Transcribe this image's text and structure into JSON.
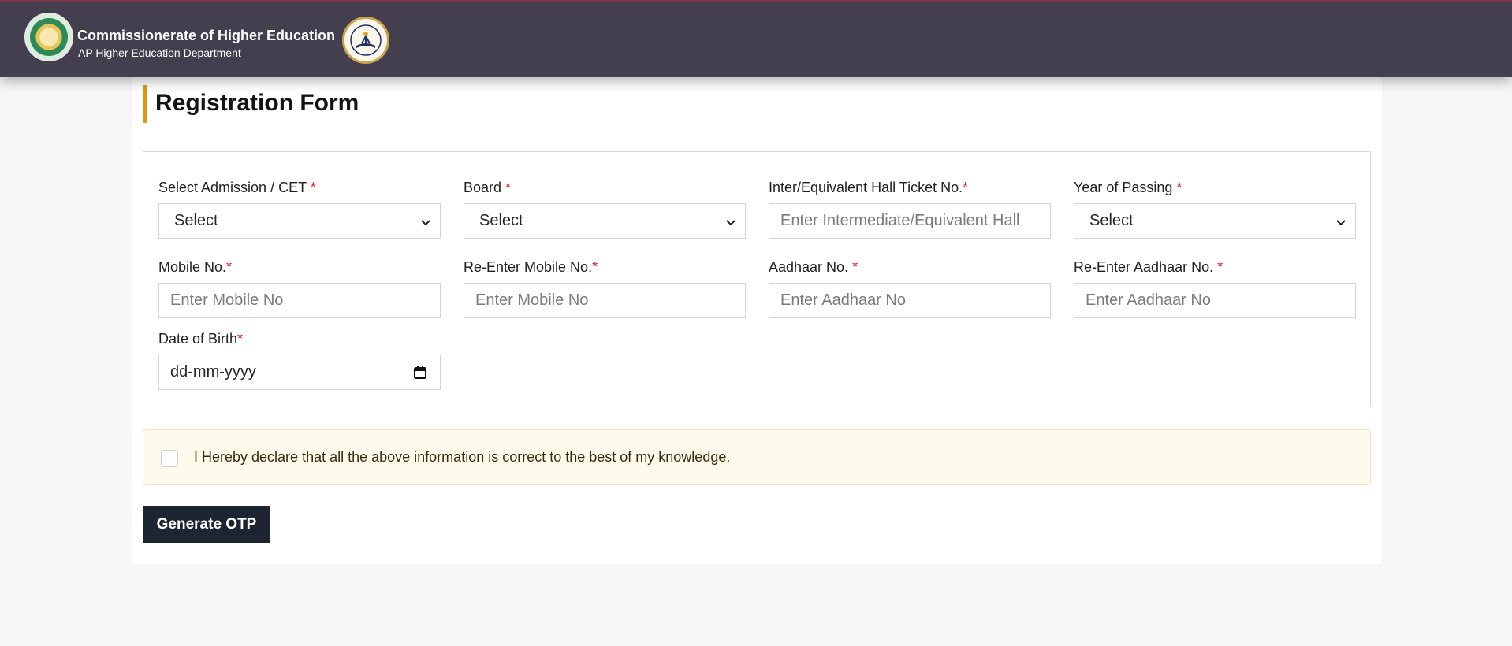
{
  "header": {
    "title": "Commissionerate of Higher Education",
    "subtitle": "AP Higher Education Department",
    "emblem_icon": "ap-state-emblem-icon",
    "logo_icon": "higher-education-seal-icon",
    "colors": {
      "bar": "#433f4f",
      "accent": "#dc9a14"
    }
  },
  "page": {
    "title": "Registration Form"
  },
  "form": {
    "admission": {
      "label": "Select Admission / CET ",
      "required": "*",
      "value": "Select"
    },
    "board": {
      "label": "Board ",
      "required": "*",
      "value": "Select"
    },
    "hall_ticket": {
      "label": "Inter/Equivalent Hall Ticket No.",
      "required": "*",
      "placeholder": "Enter Intermediate/Equivalent Hall"
    },
    "year": {
      "label": "Year of Passing ",
      "required": "*",
      "value": "Select"
    },
    "mobile": {
      "label": "Mobile No.",
      "required": "*",
      "placeholder": "Enter Mobile No"
    },
    "mobile_confirm": {
      "label": "Re-Enter Mobile No.",
      "required": "*",
      "placeholder": "Enter Mobile No"
    },
    "aadhaar": {
      "label": "Aadhaar No. ",
      "required": "*",
      "placeholder": "Enter Aadhaar No"
    },
    "aadhaar_confirm": {
      "label": "Re-Enter Aadhaar No. ",
      "required": "*",
      "placeholder": "Enter Aadhaar No"
    },
    "dob": {
      "label": "Date of Birth",
      "required": "*",
      "placeholder": "dd-mm-yyyy"
    }
  },
  "declaration": {
    "text": "I Hereby declare that all the above information is correct to the best of my knowledge.",
    "checked": false
  },
  "actions": {
    "generate_otp": "Generate OTP"
  }
}
